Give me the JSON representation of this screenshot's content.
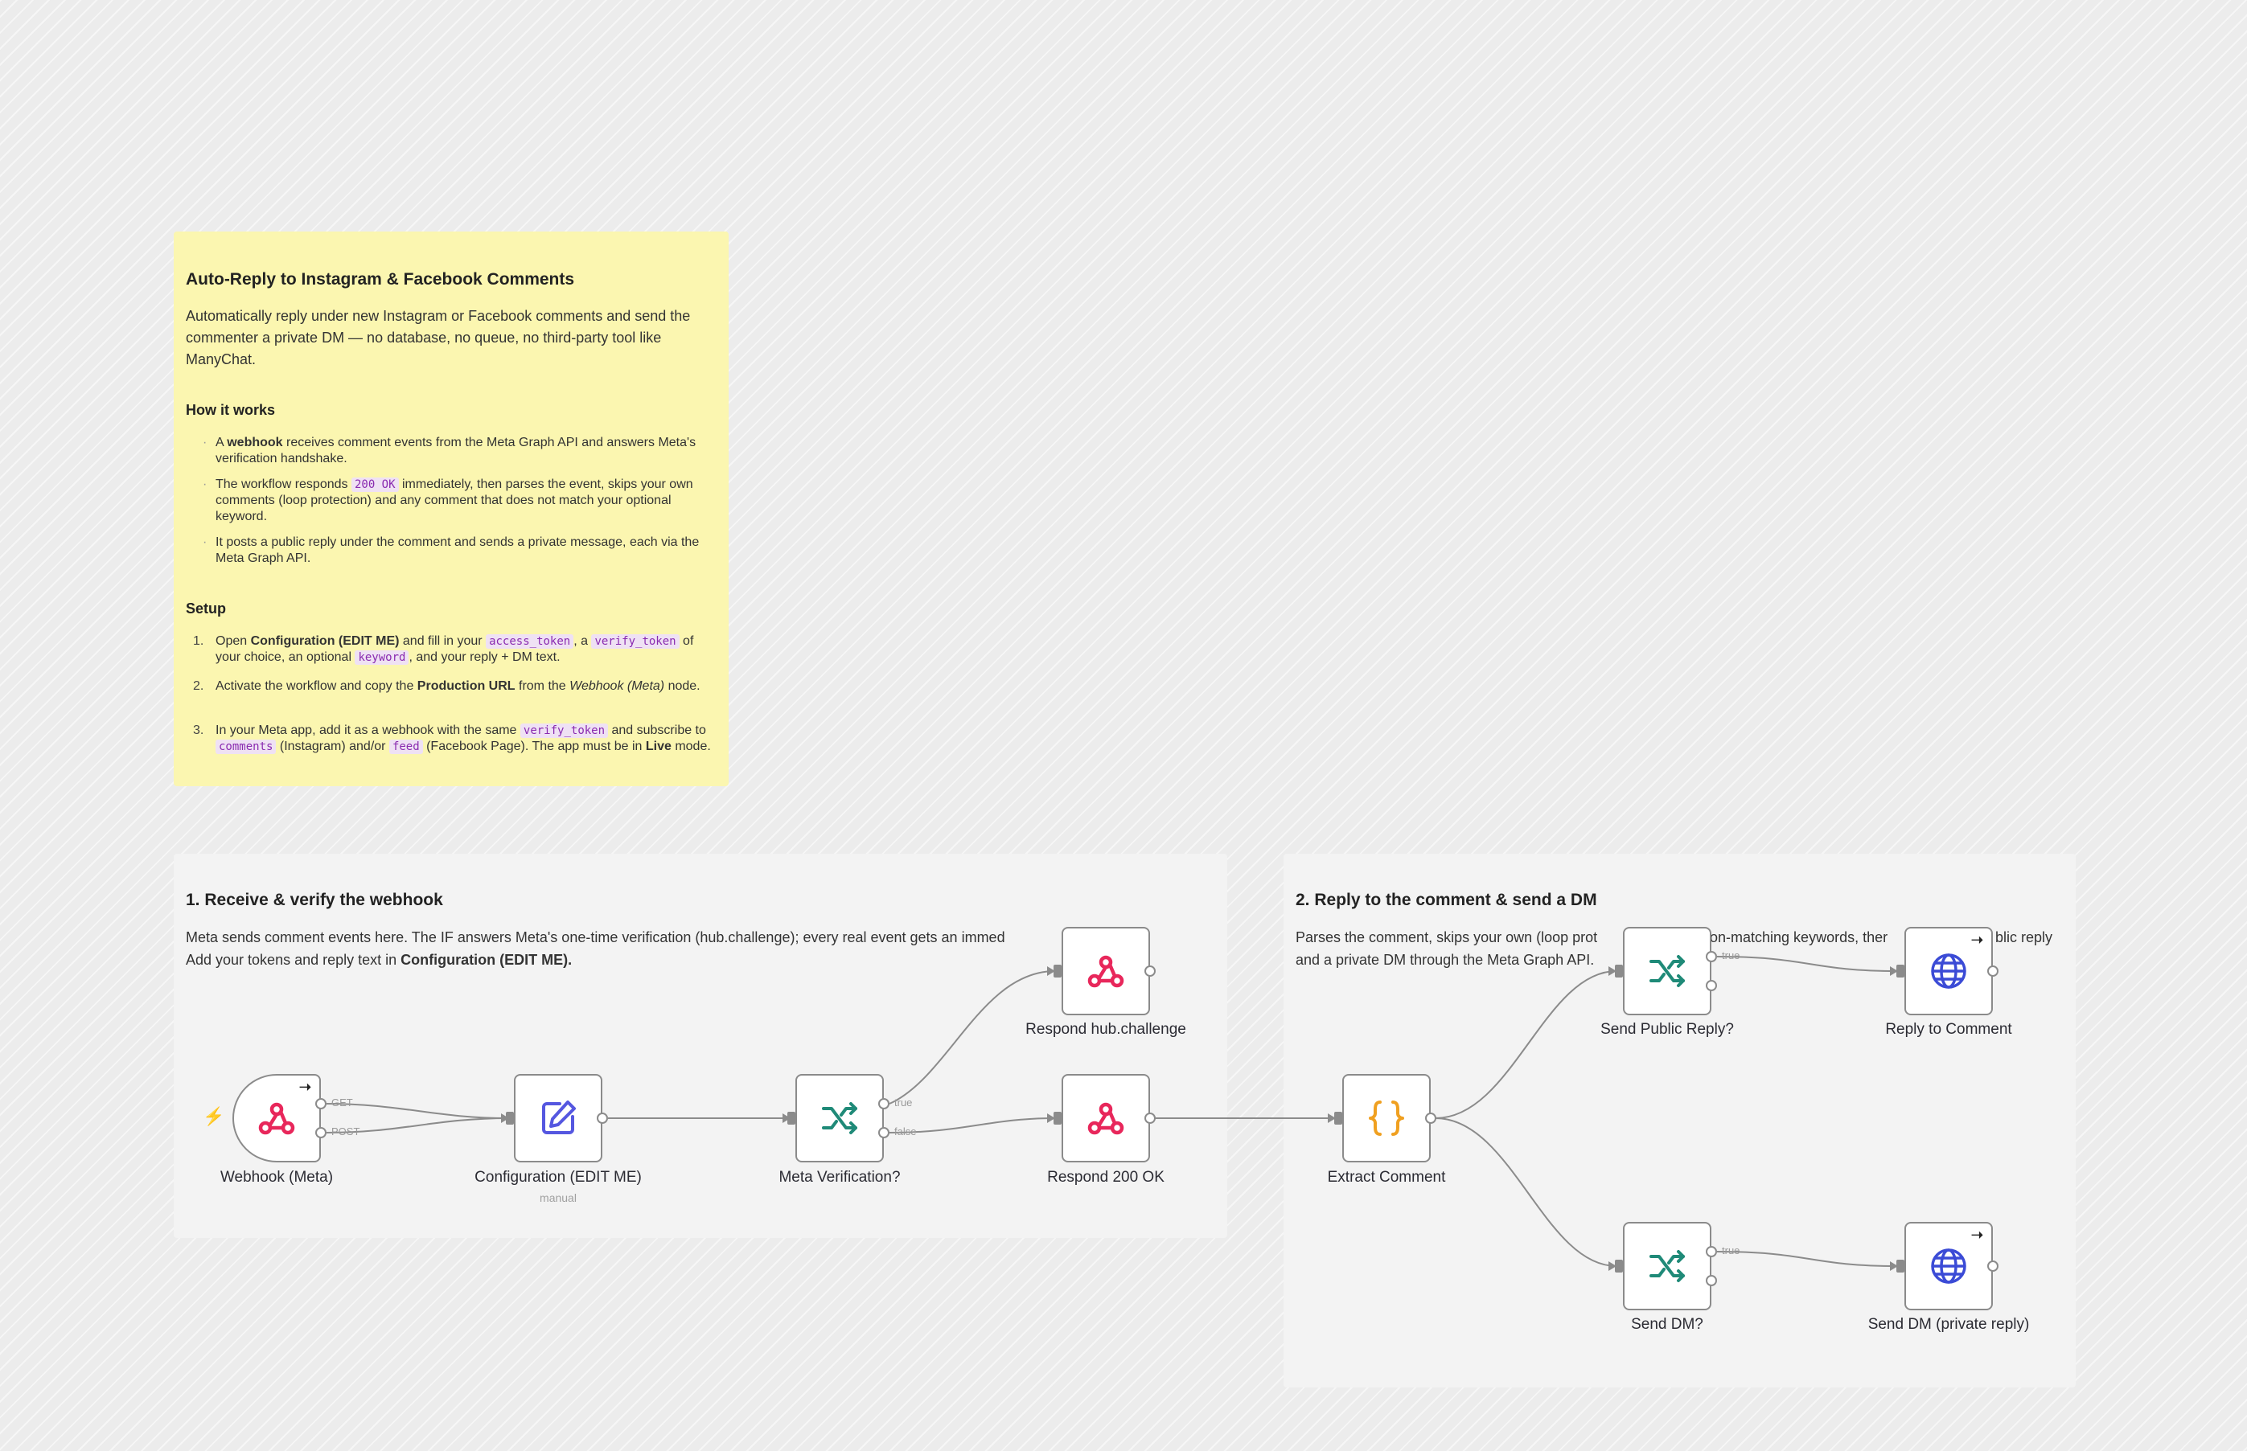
{
  "intro_note": {
    "title": "Auto-Reply to Instagram & Facebook Comments",
    "description": "Automatically reply under new Instagram or Facebook comments and send the commenter a private DM — no database, no queue, no third-party tool like ManyChat.",
    "how_heading": "How it works",
    "how_items": [
      {
        "pre": "A ",
        "bold": "webhook",
        "post": " receives comment events from the Meta Graph API and answers Meta's verification handshake."
      },
      {
        "pre": "The workflow responds ",
        "code": "200 OK",
        "post": " immediately, then parses the event, skips your own comments (loop protection) and any comment that does not match your optional keyword."
      },
      {
        "pre": "It posts a public reply under the comment and sends a private message, each via the Meta Graph API."
      }
    ],
    "setup_heading": "Setup",
    "setup_items": [
      {
        "num": "1.",
        "parts": [
          "Open ",
          "Configuration (EDIT ME)",
          " and fill in your ",
          "access_token",
          ", a ",
          "verify_token",
          " of your choice, an optional ",
          "keyword",
          ", and your reply + DM text."
        ]
      },
      {
        "num": "2.",
        "parts": [
          "Activate the workflow and copy the ",
          "Production URL",
          " from the ",
          "Webhook (Meta)",
          " node."
        ]
      },
      {
        "num": "3.",
        "parts": [
          "In your Meta app, add it as a webhook with the same ",
          "verify_token",
          " and subscribe to ",
          "comments",
          " (Instagram) and/or ",
          "feed",
          " (Facebook Page). The app must be in ",
          "Live",
          " mode."
        ]
      }
    ]
  },
  "section1": {
    "title": "1. Receive & verify the webhook",
    "desc_pre": "Meta sends comment events here. The IF answers Meta's one-time verification (hub.challenge); every real event gets an immed",
    "desc_mid": "Add your tokens and reply text in ",
    "desc_bold": "Configuration (EDIT ME)."
  },
  "section2": {
    "title": "2. Reply to the comment & send a DM",
    "desc_a": "Parses the comment, skips your own (loop prot",
    "desc_b": "on-matching keywords, ther",
    "desc_c": "blic reply",
    "desc_d": "and a private DM through the Meta Graph API."
  },
  "nodes": {
    "webhook": {
      "label": "Webhook (Meta)",
      "icon": "webhook-icon"
    },
    "config": {
      "label": "Configuration (EDIT ME)",
      "sub": "manual",
      "icon": "edit-icon"
    },
    "meta_verification": {
      "label": "Meta Verification?",
      "icon": "if-branch-icon"
    },
    "respond_hub": {
      "label": "Respond hub.challenge",
      "icon": "webhook-icon"
    },
    "respond_200": {
      "label": "Respond 200 OK",
      "icon": "webhook-icon"
    },
    "extract": {
      "label": "Extract Comment",
      "icon": "code-braces-icon"
    },
    "send_public_q": {
      "label": "Send Public Reply?",
      "icon": "if-branch-icon"
    },
    "reply_comment": {
      "label": "Reply to Comment",
      "icon": "globe-icon"
    },
    "send_dm_q": {
      "label": "Send DM?",
      "icon": "if-branch-icon"
    },
    "send_dm": {
      "label": "Send DM (private reply)",
      "icon": "globe-icon"
    }
  },
  "branch_labels": {
    "get": "GET",
    "post": "POST",
    "true": "true",
    "false": "false"
  },
  "colors": {
    "webhook": "#e8275b",
    "edit": "#5557e0",
    "if": "#1f8a78",
    "code": "#f0a020",
    "globe": "#3b4bd6",
    "edge": "#8b8b8b",
    "note_yellow": "#fbf6b0",
    "section_gray": "#f3f3f3"
  }
}
